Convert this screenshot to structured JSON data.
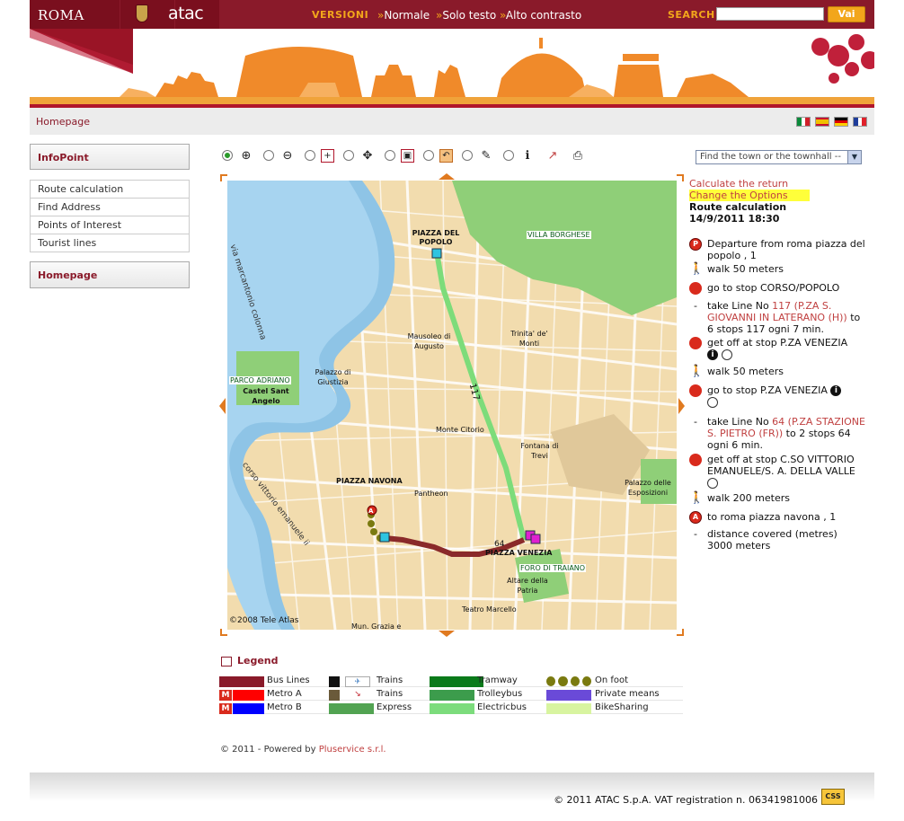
{
  "header": {
    "roma": "ROMA",
    "atac": "atac",
    "versions_label": "VERSIONI",
    "version_links": [
      "Normale",
      "Solo testo",
      "Alto contrasto"
    ],
    "search_label": "SEARCH",
    "search_value": "",
    "search_button": "Vai"
  },
  "breadcrumb": {
    "home": "Homepage"
  },
  "sidebar": {
    "infopoint": "InfoPoint",
    "items": [
      "Route calculation",
      "Find Address",
      "Points of Interest",
      "Tourist lines"
    ],
    "homepage": "Homepage"
  },
  "toolbar": {
    "town_select": "Find the town or the townhall --"
  },
  "map": {
    "labels": {
      "piazza_popolo": "PIAZZA DEL POPOLO",
      "villa_borghese": "VILLA BORGHESE",
      "via_marcantonio": "via marcantonio colonna",
      "mausoleo": "Mausoleo di Augusto",
      "trinita": "Trinita' de' Monti",
      "parco_adriano": "PARCO ADRIANO",
      "castel": "Castel Sant Angelo",
      "palazzo_giustizia": "Palazzo di Giustizia",
      "monte_citorio": "Monte Citorio",
      "fontana_trevi": "Fontana di Trevi",
      "piazza_navona": "PIAZZA NAVONA",
      "pantheon": "Pantheon",
      "corso_vittorio": "corso vittorio emanuele ii",
      "piazza_venezia": "PIAZZA VENEZIA",
      "foro_traiano": "FORO DI TRAIANO",
      "altare": "Altare della Patria",
      "palazzo_esposizioni": "Palazzo delle Esposizioni",
      "teatro": "Teatro Marcello",
      "mun": "Mun. Grazia e",
      "copyright": "©2008 Tele Atlas",
      "line117": "117",
      "line64": "64"
    }
  },
  "route": {
    "calc_return": "Calculate the return",
    "change_options": "Change the Options",
    "title": "Route calculation",
    "datetime": "14/9/2011 18:30",
    "steps": [
      {
        "icon": "departure-icon",
        "text": "Departure from roma piazza del popolo , 1"
      },
      {
        "icon": "walk-icon",
        "text": "walk 50 meters"
      },
      {
        "icon": "bus-stop-icon",
        "text": "go to stop CORSO/POPOLO"
      },
      {
        "icon": "dash",
        "pre": "take Line No ",
        "link": "117 (P.ZA S. GIOVANNI IN LATERANO (H))",
        "post": " to 6 stops 117 ogni 7 min."
      },
      {
        "icon": "bus-stop-icon",
        "text": "get off at stop P.ZA VENEZIA"
      },
      {
        "icon": "walk-icon",
        "text": "walk 50 meters"
      },
      {
        "icon": "bus-stop-icon",
        "text": "go to stop P.ZA VENEZIA"
      },
      {
        "icon": "dash",
        "pre": "take Line No ",
        "link": "64 (P.ZA STAZIONE S. PIETRO (FR))",
        "post": " to 2 stops 64 ogni 6 min."
      },
      {
        "icon": "bus-stop-icon",
        "text": "get off at stop C.SO VITTORIO EMANUELE/S. A. DELLA VALLE"
      },
      {
        "icon": "walk-icon",
        "text": "walk 200 meters"
      },
      {
        "icon": "arrival-icon",
        "text": "to roma piazza navona , 1"
      },
      {
        "icon": "dash",
        "text": "distance covered (metres) 3000 meters"
      }
    ]
  },
  "legend": {
    "title": "Legend",
    "items": {
      "bus_lines": "Bus Lines",
      "metro_a": "Metro A",
      "metro_b": "Metro B",
      "trains1": "Trains",
      "trains2": "Trains",
      "express": "Express",
      "tramway": "Tramway",
      "trolleybus": "Trolleybus",
      "electricbus": "Electricbus",
      "on_foot": "On foot",
      "private": "Private means",
      "bikesharing": "BikeSharing"
    },
    "colors": {
      "bus": "#8a1a2a",
      "metro_a": "#ff0000",
      "metro_b": "#0000ff",
      "express": "#52a352",
      "tramway": "#0a7a1a",
      "trolleybus": "#3c9c4c",
      "electricbus": "#7cdc7c",
      "on_foot": "#7a7a10",
      "private": "#6a4ad8",
      "bikesharing": "#d8f4a0"
    }
  },
  "footer": {
    "powered_pre": "© 2011 - Powered by ",
    "powered_link": "Pluservice s.r.l.",
    "copyright": "© 2011 ATAC S.p.A. VAT registration n. 06341981006",
    "css_badge": "CSS"
  }
}
